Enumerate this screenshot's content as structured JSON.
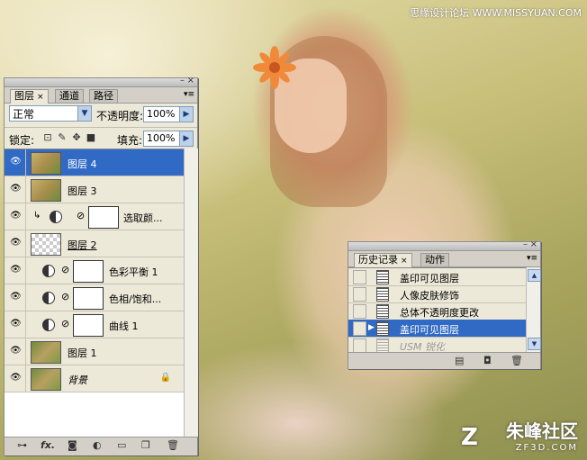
{
  "watermark": {
    "top": "思缘设计论坛  WWW.MISSYUAN.COM",
    "brand_name": "朱峰社区",
    "brand_url": "ZF3D.COM",
    "brand_logo_glyph": "Z"
  },
  "layers_panel": {
    "tabs": [
      {
        "label": "图层",
        "active": true
      },
      {
        "label": "通道",
        "active": false
      },
      {
        "label": "路径",
        "active": false
      }
    ],
    "blend_mode": "正常",
    "opacity_label": "不透明度:",
    "opacity_value": "100%",
    "lock_label": "锁定:",
    "fill_label": "填充:",
    "fill_value": "100%",
    "layers": [
      {
        "name": "图层 4",
        "selected": true
      },
      {
        "name": "图层 3"
      },
      {
        "name": "选取颜..."
      },
      {
        "name": "图层 2"
      },
      {
        "name": "色彩平衡 1"
      },
      {
        "name": "色相/饱和..."
      },
      {
        "name": "曲线 1"
      },
      {
        "name": "图层 1"
      },
      {
        "name": "背景"
      }
    ],
    "footer_fx": "fx."
  },
  "history_panel": {
    "tabs": [
      {
        "label": "历史记录",
        "active": true
      },
      {
        "label": "动作",
        "active": false
      }
    ],
    "states": [
      {
        "name": "盖印可见图层"
      },
      {
        "name": "人像皮肤修饰"
      },
      {
        "name": "总体不透明度更改"
      },
      {
        "name": "盖印可见图层",
        "selected": true
      },
      {
        "name": "USM 锐化",
        "dimmed": true
      }
    ]
  }
}
